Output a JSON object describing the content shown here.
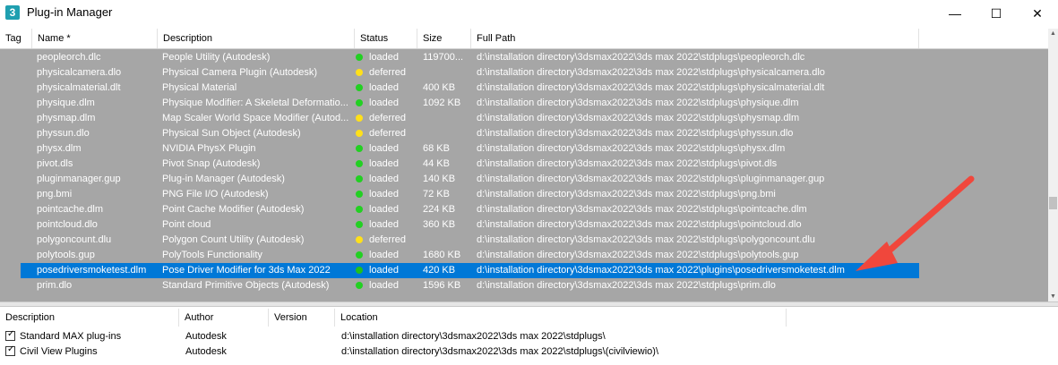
{
  "window": {
    "title": "Plug-in Manager",
    "app_icon_text": "3",
    "minimize_label": "—",
    "maximize_label": "☐",
    "close_label": "✕"
  },
  "columns": {
    "tag": "Tag",
    "name": "Name *",
    "description": "Description",
    "status": "Status",
    "size": "Size",
    "path": "Full Path"
  },
  "status_colors": {
    "loaded": "#22d022",
    "deferred": "#ffe01a",
    "selected_loaded": "#22c01c"
  },
  "rows": [
    {
      "name": "peopleorch.dlc",
      "description": "People Utility  (Autodesk)",
      "status": "loaded",
      "size": "119700...",
      "path": "d:\\installation directory\\3dsmax2022\\3ds max 2022\\stdplugs\\peopleorch.dlc"
    },
    {
      "name": "physicalcamera.dlo",
      "description": "Physical Camera Plugin (Autodesk)",
      "status": "deferred",
      "size": "",
      "path": "d:\\installation directory\\3dsmax2022\\3ds max 2022\\stdplugs\\physicalcamera.dlo"
    },
    {
      "name": "physicalmaterial.dlt",
      "description": "Physical Material",
      "status": "loaded",
      "size": "400 KB",
      "path": "d:\\installation directory\\3dsmax2022\\3ds max 2022\\stdplugs\\physicalmaterial.dlt"
    },
    {
      "name": "physique.dlm",
      "description": "Physique Modifier: A Skeletal Deformatio...",
      "status": "loaded",
      "size": "1092 KB",
      "path": "d:\\installation directory\\3dsmax2022\\3ds max 2022\\stdplugs\\physique.dlm"
    },
    {
      "name": "physmap.dlm",
      "description": "Map Scaler World Space Modifier (Autod...",
      "status": "deferred",
      "size": "",
      "path": "d:\\installation directory\\3dsmax2022\\3ds max 2022\\stdplugs\\physmap.dlm"
    },
    {
      "name": "physsun.dlo",
      "description": "Physical Sun Object (Autodesk)",
      "status": "deferred",
      "size": "",
      "path": "d:\\installation directory\\3dsmax2022\\3ds max 2022\\stdplugs\\physsun.dlo"
    },
    {
      "name": "physx.dlm",
      "description": "NVIDIA PhysX Plugin",
      "status": "loaded",
      "size": "68 KB",
      "path": "d:\\installation directory\\3dsmax2022\\3ds max 2022\\stdplugs\\physx.dlm"
    },
    {
      "name": "pivot.dls",
      "description": "Pivot Snap (Autodesk)",
      "status": "loaded",
      "size": "44 KB",
      "path": "d:\\installation directory\\3dsmax2022\\3ds max 2022\\stdplugs\\pivot.dls"
    },
    {
      "name": "pluginmanager.gup",
      "description": "Plug-in Manager (Autodesk)",
      "status": "loaded",
      "size": "140 KB",
      "path": "d:\\installation directory\\3dsmax2022\\3ds max 2022\\stdplugs\\pluginmanager.gup"
    },
    {
      "name": "png.bmi",
      "description": "PNG File I/O (Autodesk)",
      "status": "loaded",
      "size": "72 KB",
      "path": "d:\\installation directory\\3dsmax2022\\3ds max 2022\\stdplugs\\png.bmi"
    },
    {
      "name": "pointcache.dlm",
      "description": "Point Cache Modifier (Autodesk)",
      "status": "loaded",
      "size": "224 KB",
      "path": "d:\\installation directory\\3dsmax2022\\3ds max 2022\\stdplugs\\pointcache.dlm"
    },
    {
      "name": "pointcloud.dlo",
      "description": "Point cloud",
      "status": "loaded",
      "size": "360 KB",
      "path": "d:\\installation directory\\3dsmax2022\\3ds max 2022\\stdplugs\\pointcloud.dlo"
    },
    {
      "name": "polygoncount.dlu",
      "description": "Polygon Count Utility (Autodesk)",
      "status": "deferred",
      "size": "",
      "path": "d:\\installation directory\\3dsmax2022\\3ds max 2022\\stdplugs\\polygoncount.dlu"
    },
    {
      "name": "polytools.gup",
      "description": "PolyTools Functionality",
      "status": "loaded",
      "size": "1680 KB",
      "path": "d:\\installation directory\\3dsmax2022\\3ds max 2022\\stdplugs\\polytools.gup"
    },
    {
      "name": "posedriversmoketest.dlm",
      "description": "Pose Driver Modifier for 3ds Max 2022",
      "status": "loaded",
      "size": "420 KB",
      "path": "d:\\installation directory\\3dsmax2022\\3ds max 2022\\plugins\\posedriversmoketest.dlm",
      "selected": true
    },
    {
      "name": "prim.dlo",
      "description": "Standard Primitive Objects (Autodesk)",
      "status": "loaded",
      "size": "1596 KB",
      "path": "d:\\installation directory\\3dsmax2022\\3ds max 2022\\stdplugs\\prim.dlo"
    }
  ],
  "bottom": {
    "columns": {
      "description": "Description",
      "author": "Author",
      "version": "Version",
      "location": "Location"
    },
    "rows": [
      {
        "description": "Standard MAX plug-ins",
        "author": "Autodesk",
        "version": "",
        "location": "d:\\installation directory\\3dsmax2022\\3ds max 2022\\stdplugs\\",
        "checked": true
      },
      {
        "description": "Civil View Plugins",
        "author": "Autodesk",
        "version": "",
        "location": "d:\\installation directory\\3dsmax2022\\3ds max 2022\\stdplugs\\(civilviewio)\\",
        "checked": true
      }
    ]
  },
  "annotation": {
    "arrow_color": "#f0473c"
  }
}
